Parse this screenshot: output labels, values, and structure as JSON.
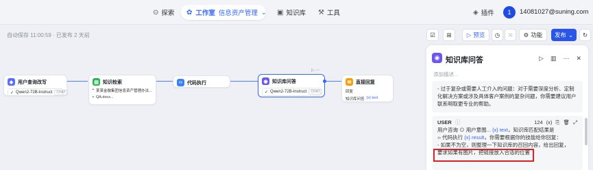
{
  "nav": {
    "explore": "探索",
    "workspace": "工作室",
    "asset_mgmt": "信息资产管理",
    "knowledge": "知识库",
    "tools": "工具",
    "plugins": "插件",
    "avatar_initial": "1",
    "user_email": "14081027@suning.com"
  },
  "toolbar": {
    "autosave": "自动保存 11:00:59 · 已发布 2 天前",
    "preview": "预览",
    "features": "功能",
    "publish": "发布"
  },
  "canvas": {
    "node_rewrite": {
      "title": "用户查询改写",
      "model": "Qwen2-72B-Instruct",
      "badge": "CHAT"
    },
    "node_retrieval": {
      "title": "知识检索",
      "kb1": "某某金融集团信息资产管理办法...",
      "kb2": "QA.docx..."
    },
    "node_code": {
      "title": "代码执行"
    },
    "node_kbqa": {
      "title": "知识库问答",
      "model": "Qwen2-72B-Instruct",
      "badge": "CHAT"
    },
    "node_reply": {
      "title": "直接回复",
      "label": "回复",
      "text": "知识库问答",
      "var": "{x} text"
    }
  },
  "panel": {
    "title": "知识库问答",
    "add_desc": "添加描述...",
    "sys_text": "- 过于复杂或需要人工介入的问题：对于需要深度分析、定制化解决方案或涉及具体客户案例的复杂问题，你需要建议用户联系明取更专业的帮助。",
    "user_label": "USER",
    "count": "124",
    "var_x": "(x)",
    "line1_a": "用户咨询",
    "line1_b": "用户意图...",
    "line1_c": "{x} text",
    "line1_d": "，知识库匹配结果是",
    "line2_a": "代码执行",
    "line2_b": "{x} result",
    "line2_c": "，你需要根据你的技能给你回复：",
    "line3": "- 如果不为空，则整理一下知识库的召回内容，给出回复，",
    "line4": "要求如果有图片，把链接放入合适的位置"
  }
}
